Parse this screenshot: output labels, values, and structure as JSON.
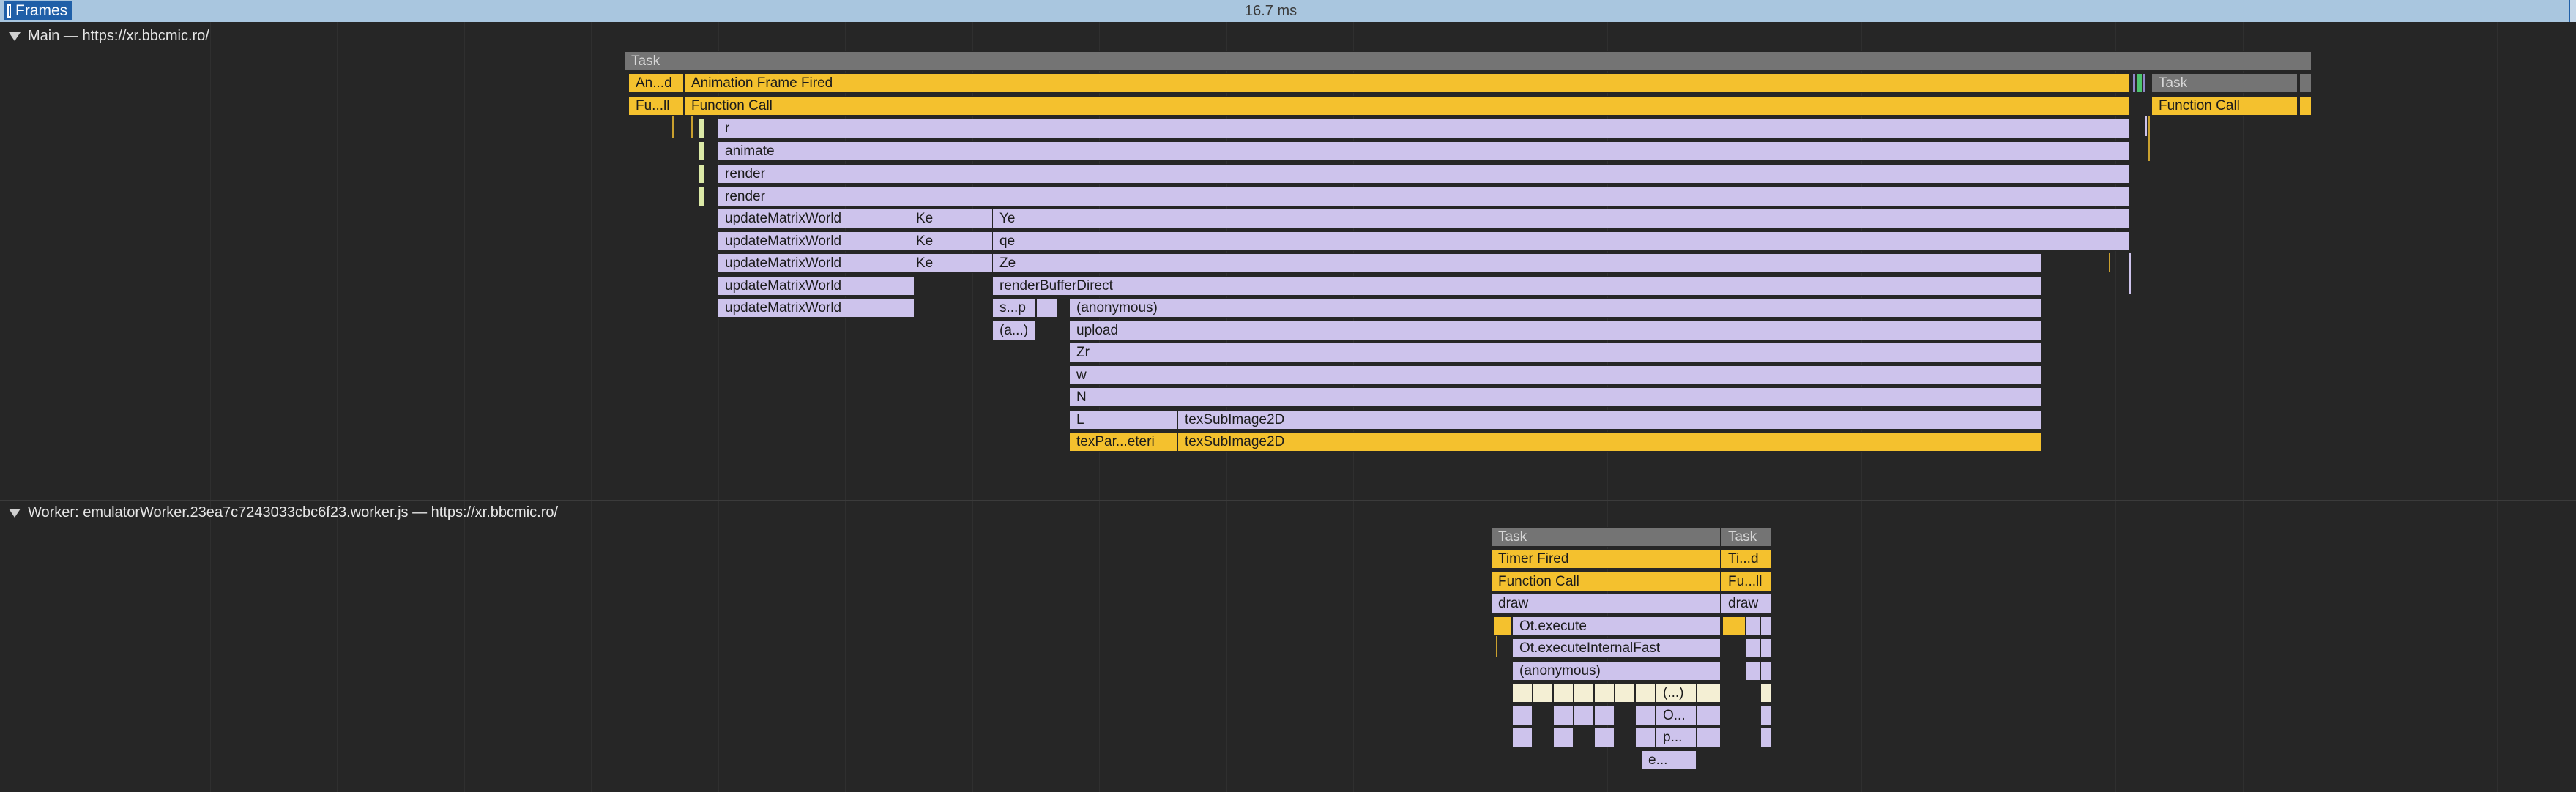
{
  "frames_track": {
    "label": "Frames",
    "duration": "16.7 ms"
  },
  "main_track": {
    "title": "Main — https://xr.bbcmic.ro/",
    "task_label": "Task",
    "task2_label": "Task",
    "animation_frame_short": "An...d",
    "animation_frame_label": "Animation Frame Fired",
    "function_call_short": "Fu...ll",
    "function_call_label": "Function Call",
    "function_call_right": "Function Call",
    "stack": {
      "r": "r",
      "animate": "animate",
      "render1": "render",
      "render2": "render",
      "umw": "updateMatrixWorld",
      "ke": "Ke",
      "ye": "Ye",
      "qe": "qe",
      "ze": "Ze",
      "render_buffer_direct": "renderBufferDirect",
      "sp": "s...p",
      "a_short": "(a...)",
      "anonymous": "(anonymous)",
      "upload": "upload",
      "zr": "Zr",
      "w": "w",
      "n": "N",
      "l": "L",
      "tex_sub_image": "texSubImage2D",
      "tex_par": "texPar...eteri",
      "tex_sub_image_gl": "texSubImage2D"
    }
  },
  "worker_track": {
    "title": "Worker: emulatorWorker.23ea7c7243033cbc6f23.worker.js — https://xr.bbcmic.ro/",
    "task_label": "Task",
    "task2_label": "Task",
    "timer_fired": "Timer Fired",
    "timer_fired_short": "Ti...d",
    "function_call": "Function Call",
    "function_call_short": "Fu...ll",
    "draw": "draw",
    "draw2": "draw",
    "ot_execute": "Ot.execute",
    "ot_execute_internal_fast": "Ot.executeInternalFast",
    "anonymous": "(anonymous)",
    "ellipsis": "(...)",
    "o_short": "O...",
    "p_short": "p...",
    "e_short": "e..."
  },
  "colors": {
    "background": "#262626",
    "task": "#747474",
    "event": "#f4c12e",
    "javascript": "#cdc3ec",
    "frames_bar": "#a9c6df",
    "frame_selected": "#1f5fa8"
  }
}
